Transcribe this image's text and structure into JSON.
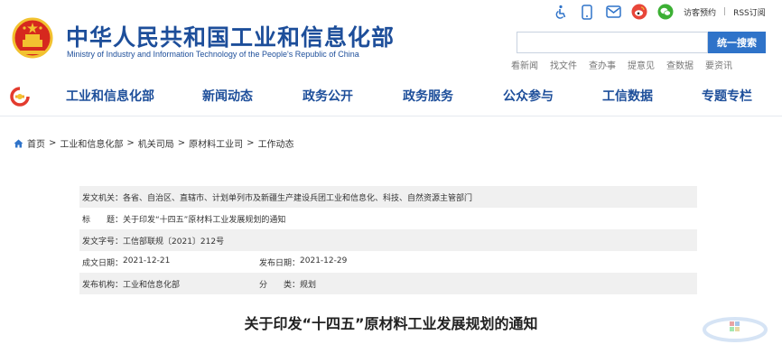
{
  "header": {
    "title": "中华人民共和国工业和信息化部",
    "subtitle": "Ministry of Industry and Information Technology of the People's Republic of China",
    "top_links": [
      "访客预约",
      "RSS订阅"
    ],
    "top_separator": "|",
    "top_icons": [
      "accessibility-icon",
      "mobile-icon",
      "mail-icon",
      "weibo-icon",
      "wechat-icon"
    ],
    "search_button": "统一搜索",
    "search_value": "",
    "quick_links": [
      "看新闻",
      "找文件",
      "查办事",
      "提意见",
      "查数据",
      "要资讯"
    ]
  },
  "nav": {
    "items": [
      "工业和信息化部",
      "新闻动态",
      "政务公开",
      "政务服务",
      "公众参与",
      "工信数据",
      "专题专栏"
    ]
  },
  "breadcrumb": {
    "items": [
      "首页",
      "工业和信息化部",
      "机关司局",
      "原材料工业司",
      "工作动态"
    ],
    "separator": ">"
  },
  "info": {
    "issuer_label": "发文机关：",
    "issuer_value": "各省、自治区、直辖市、计划单列市及新疆生产建设兵团工业和信息化、科技、自然资源主管部门",
    "title_label": "标　　题：",
    "title_value": "关于印发“十四五”原材料工业发展规划的通知",
    "docno_label": "发文字号：",
    "docno_value": "工信部联规〔2021〕212号",
    "created_label": "成文日期：",
    "created_value": "2021-12-21",
    "published_label": "发布日期：",
    "published_value": "2021-12-29",
    "org_label": "发布机构：",
    "org_value": "工业和信息化部",
    "category_label": "分　　类：",
    "category_value": "规划"
  },
  "article": {
    "title": "关于印发“十四五”原材料工业发展规划的通知"
  },
  "colors": {
    "brand_blue": "#1d4e9a",
    "search_button": "#2f73c9",
    "emblem_red": "#d6281e",
    "emblem_gold": "#f2c230"
  }
}
